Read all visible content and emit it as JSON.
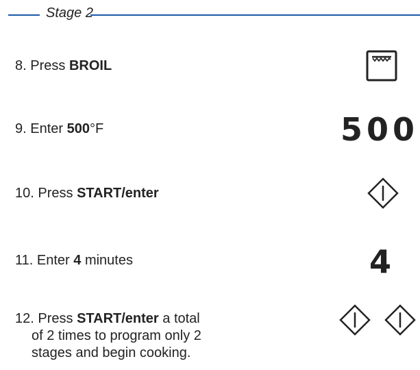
{
  "stage": {
    "title": "Stage 2"
  },
  "steps": [
    {
      "number": "8.",
      "prefix": "Press",
      "bold": "BROIL",
      "suffix": "",
      "icon": "oven-broil-icon"
    },
    {
      "number": "9.",
      "prefix": "Enter",
      "bold": "500",
      "suffix": "°F",
      "display": "500"
    },
    {
      "number": "10.",
      "prefix": "Press",
      "bold": "START/enter",
      "suffix": "",
      "icon": "start-enter-icon"
    },
    {
      "number": "11.",
      "prefix": "Enter",
      "bold": "4",
      "suffix": "minutes",
      "display": "4"
    },
    {
      "number": "12.",
      "prefix": "Press",
      "bold": "START/enter",
      "suffix": "a total",
      "line2": "of 2 times to program only 2",
      "line3": "stages and begin cooking.",
      "icon": "start-enter-icon",
      "icon_count": 2
    }
  ],
  "colors": {
    "accent": "#1a5aa6",
    "text": "#222222"
  }
}
